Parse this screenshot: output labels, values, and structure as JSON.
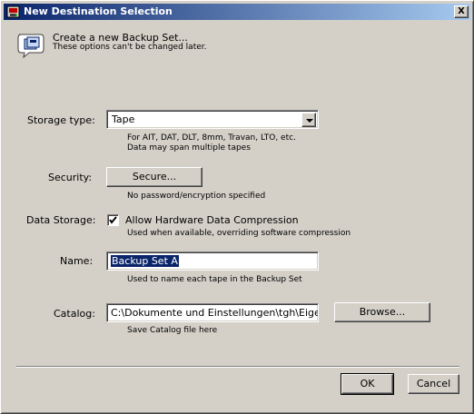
{
  "window": {
    "title": "New Destination Selection",
    "close_glyph": "X"
  },
  "header": {
    "title": "Create a new Backup Set...",
    "subtitle": "These options can't be changed later."
  },
  "storage_type": {
    "label": "Storage type:",
    "value": "Tape",
    "hint_line1": "For AIT, DAT, DLT, 8mm, Travan, LTO, etc.",
    "hint_line2": "Data may span multiple tapes"
  },
  "security": {
    "label": "Security:",
    "button": "Secure...",
    "hint": "No password/encryption specified"
  },
  "data_storage": {
    "label": "Data Storage:",
    "checkbox_label": "Allow Hardware Data Compression",
    "checked": true,
    "hint": "Used when available, overriding software compression"
  },
  "name": {
    "label": "Name:",
    "value": "Backup Set A",
    "hint": "Used to name each tape in the Backup Set"
  },
  "catalog": {
    "label": "Catalog:",
    "value": "C:\\Dokumente und Einstellungen\\tgh\\Eigene Da",
    "browse_button": "Browse...",
    "hint": "Save Catalog file here"
  },
  "footer": {
    "ok": "OK",
    "cancel": "Cancel"
  },
  "colors": {
    "title_bar_start": "#0a246a",
    "title_bar_end": "#a6caf0",
    "dialog_face": "#d4d0c8",
    "selection": "#0a246a"
  },
  "icons": {
    "app": "backup-app-icon",
    "header": "backup-set-icon",
    "close": "close-icon",
    "dropdown": "chevron-down-icon",
    "check": "checkmark-icon"
  }
}
